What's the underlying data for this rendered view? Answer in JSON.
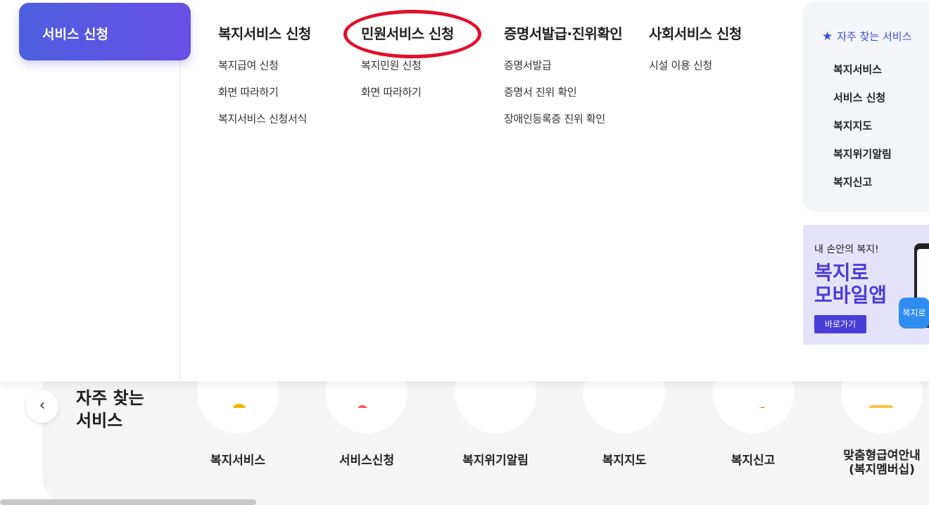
{
  "menu": {
    "active_section": "서비스 신청",
    "columns": [
      {
        "title": "복지서비스 신청",
        "links": [
          "복지급여 신청",
          "화면 따라하기",
          "복지서비스 신청서식"
        ]
      },
      {
        "title": "민원서비스 신청",
        "links": [
          "복지민원 신청",
          "화면 따라하기"
        ]
      },
      {
        "title": "증명서발급·진위확인",
        "links": [
          "증명서발급",
          "증명서 진위 확인",
          "장애인등록증 진위 확인"
        ]
      },
      {
        "title": "사회서비스 신청",
        "links": [
          "시설 이용 신청"
        ]
      }
    ],
    "highlight_color": "#e0102a"
  },
  "quick_box": {
    "heading": "자주 찾는 서비스",
    "items": [
      "복지서비스",
      "서비스 신청",
      "복지지도",
      "복지위기알림",
      "복지신고"
    ]
  },
  "app_banner": {
    "subtitle": "내 손안의 복지!",
    "title_line1": "복지로",
    "title_line2": "모바일앱",
    "button": "바로가기",
    "badge": "복지로"
  },
  "quick_services": {
    "title_line1": "자주 찾는",
    "title_line2": "서비스",
    "prev_glyph": "‹",
    "items": [
      {
        "label": "복지서비스",
        "icon": "people-icon"
      },
      {
        "label": "서비스신청",
        "icon": "hand-pointer-icon"
      },
      {
        "label": "복지위기알림",
        "icon": "chat-note-icon"
      },
      {
        "label": "복지지도",
        "icon": "building-icon"
      },
      {
        "label": "복지신고",
        "icon": "siren-icon"
      },
      {
        "label": "맞춤형급여안내\n(복지멤버십)",
        "icon": "id-card-icon"
      }
    ]
  },
  "colors": {
    "accent_gradient_start": "#4c5fe0",
    "accent_gradient_end": "#6a4fe6",
    "brand_blue": "#3b4fd8",
    "banner_purple": "#4a3cd9"
  }
}
